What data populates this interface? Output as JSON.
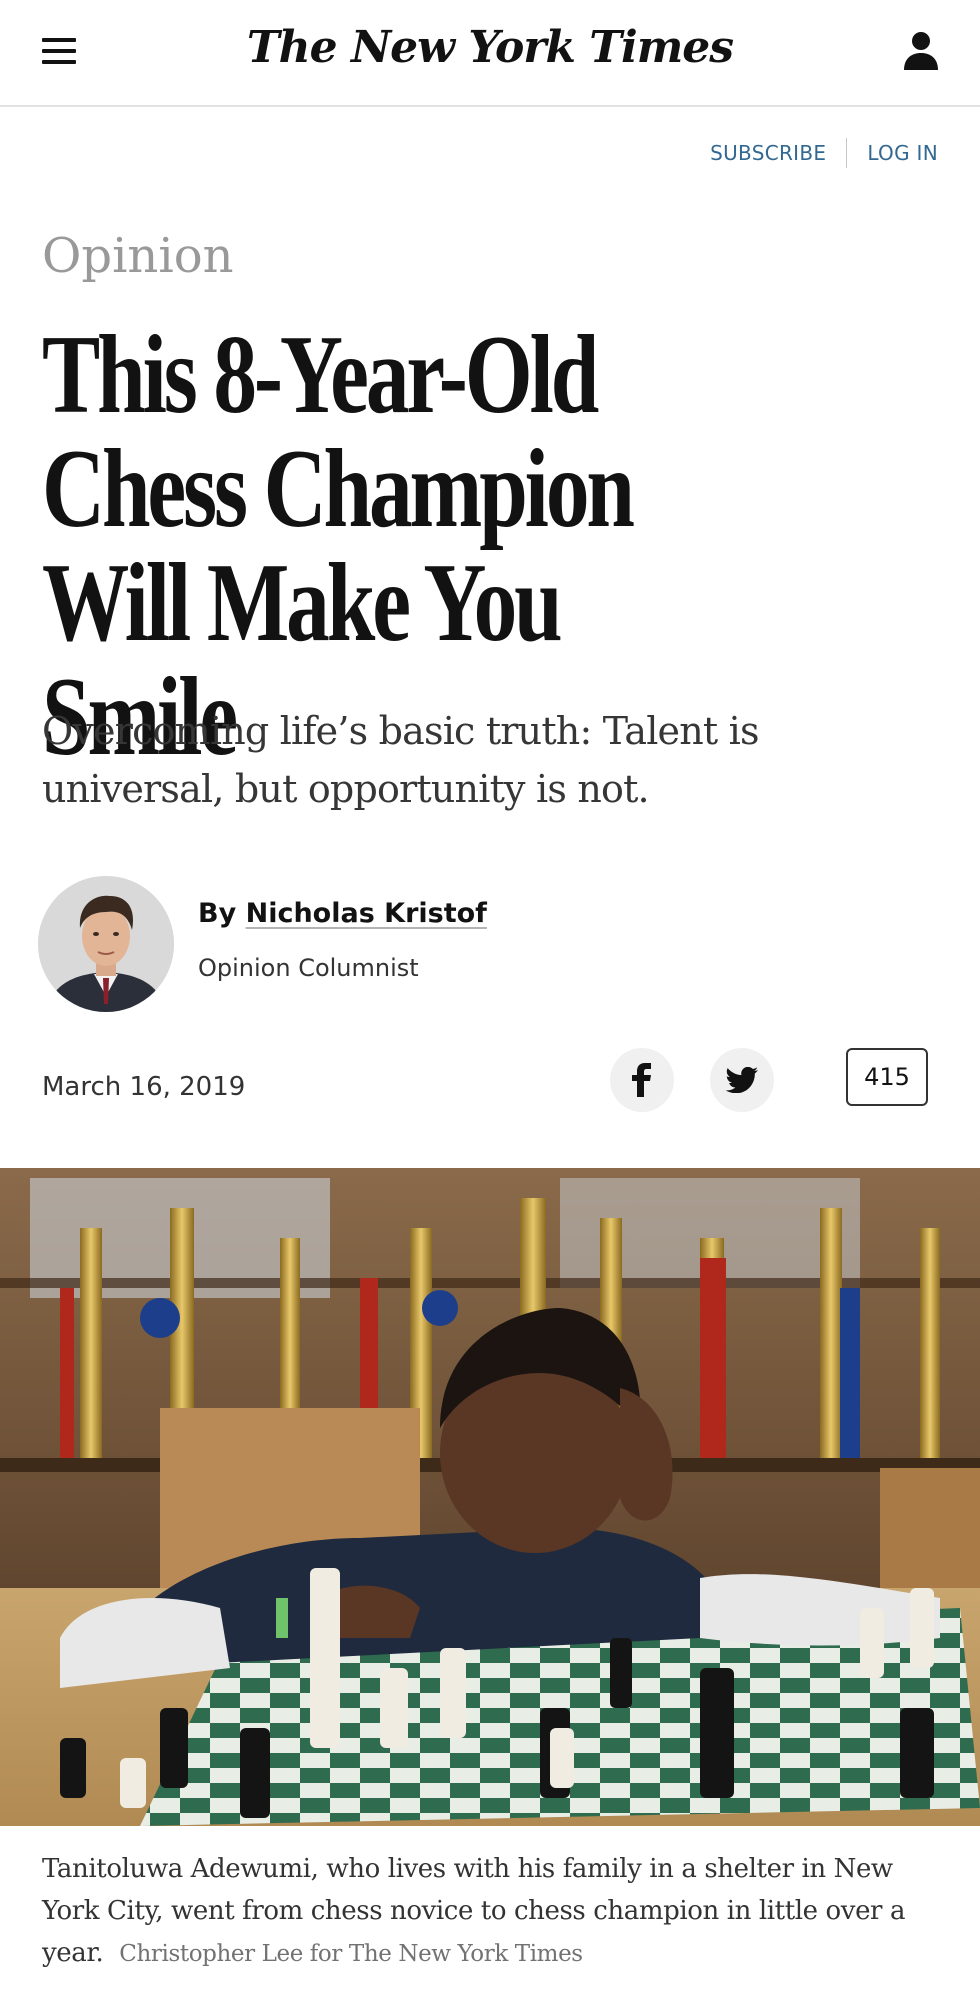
{
  "header": {
    "masthead": "The New York Times",
    "menu_icon": "hamburger-icon",
    "account_icon": "user-icon"
  },
  "auth": {
    "subscribe": "SUBSCRIBE",
    "login": "LOG IN"
  },
  "article": {
    "kicker": "Opinion",
    "headline_lines": [
      "This 8-Year-Old",
      "Chess Champion",
      "Will Make You Smile"
    ],
    "summary": "Overcoming life’s basic truth: Talent is universal, but opportunity is not.",
    "byline_prefix": "By",
    "author": "Nicholas Kristof",
    "author_role": "Opinion Columnist",
    "date": "March 16, 2019",
    "comment_count": "415",
    "share_icons": [
      "facebook-icon",
      "twitter-icon"
    ]
  },
  "photo": {
    "caption": "Tanitoluwa Adewumi, who lives with his family in a shelter in New York City, went from chess novice to chess champion in little over a year.",
    "credit": "Christopher Lee for The New York Times"
  },
  "colors": {
    "link_blue": "#326891",
    "kicker_gray": "#999999",
    "text_dark": "#121212"
  }
}
